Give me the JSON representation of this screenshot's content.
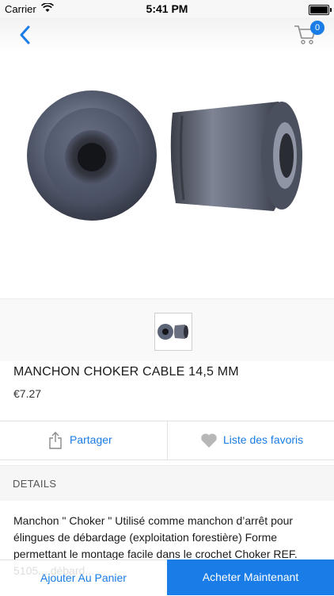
{
  "status_bar": {
    "carrier": "Carrier",
    "time": "5:41 PM"
  },
  "nav": {
    "cart_count": "0",
    "accent": "#1a7ce6"
  },
  "product": {
    "title": "MANCHON CHOKER CABLE 14,5 MM",
    "price": "€7.27"
  },
  "actions": {
    "share_label": "Partager",
    "favorites_label": "Liste des favoris"
  },
  "details": {
    "header": "DETAILS",
    "description": "Manchon \" Choker \" Utilisé comme manchon d’arrêt pour élingues de débardage (exploitation forestière) Forme permettant le montage facile dans le crochet Choker REF. 5105... débard..."
  },
  "bottom": {
    "add_to_cart": "Ajouter Au Panier",
    "buy_now": "Acheter Maintenant"
  },
  "icons": {
    "back": "chevron-left-icon",
    "cart": "cart-icon",
    "share": "share-icon",
    "favorite": "heart-icon"
  }
}
